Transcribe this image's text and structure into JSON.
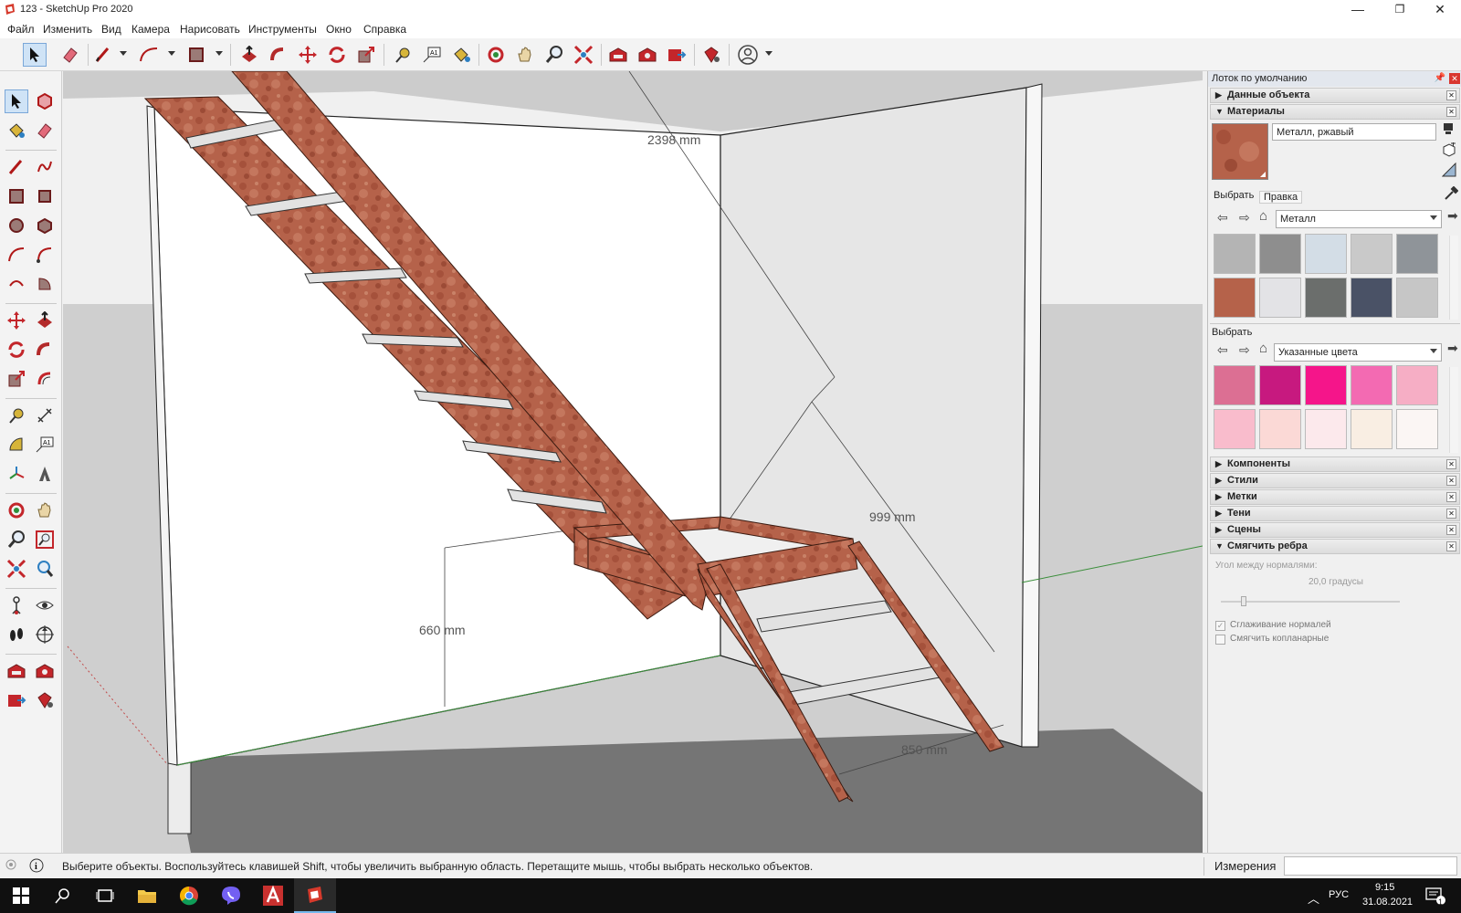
{
  "window": {
    "title": "123 - SketchUp Pro 2020",
    "minimize": "—",
    "restore": "❐",
    "close": "✕"
  },
  "menu": [
    "Файл",
    "Изменить",
    "Вид",
    "Камера",
    "Нарисовать",
    "Инструменты",
    "Окно",
    "Справка"
  ],
  "viewport": {
    "dimensions": [
      "2398 mm",
      "999 mm",
      "660 mm",
      "850 mm"
    ],
    "material": "rusty-metal"
  },
  "tray": {
    "title": "Лоток по умолчанию",
    "sections_top": [
      "Данные объекта",
      "Материалы"
    ],
    "materials": {
      "current_name": "Металл, ржавый",
      "tabs": [
        "Выбрать",
        "Правка"
      ],
      "library": "Металл",
      "secondary_label": "Выбрать",
      "secondary_library": "Указанные цвета",
      "metal_swatches": [
        "#b4b4b4",
        "#8e8e8e",
        "#d3dde6",
        "#c9c9c9",
        "#8f9499",
        "#b5624a",
        "#e3e3e6",
        "#6b6e6c",
        "#4a5266",
        "#c6c6c6"
      ],
      "color_swatches": [
        "#dc6f93",
        "#c7197f",
        "#f5158a",
        "#f36ab2",
        "#f6aec5",
        "#f9bccc",
        "#fbd9d6",
        "#fce9ec",
        "#f9eee3",
        "#fbf6f4"
      ]
    },
    "sections_bottom": [
      "Компоненты",
      "Стили",
      "Метки",
      "Тени",
      "Сцены",
      "Смягчить ребра"
    ],
    "soften": {
      "angle_label": "Угол между нормалями:",
      "angle_value": "20,0  градусы",
      "slider_fraction": 0.13,
      "smooth_normals": "Сглаживание нормалей",
      "smooth_normals_checked": true,
      "coplanar": "Смягчить копланарные",
      "coplanar_checked": false
    }
  },
  "status": {
    "message": "Выберите объекты. Воспользуйтесь клавишей Shift, чтобы увеличить выбранную область. Перетащите мышь, чтобы выбрать несколько объектов.",
    "measurements_label": "Измерения",
    "measurements_value": ""
  },
  "taskbar": {
    "lang": "РУС",
    "time": "9:15",
    "date": "31.08.2021",
    "notifications": "1"
  }
}
